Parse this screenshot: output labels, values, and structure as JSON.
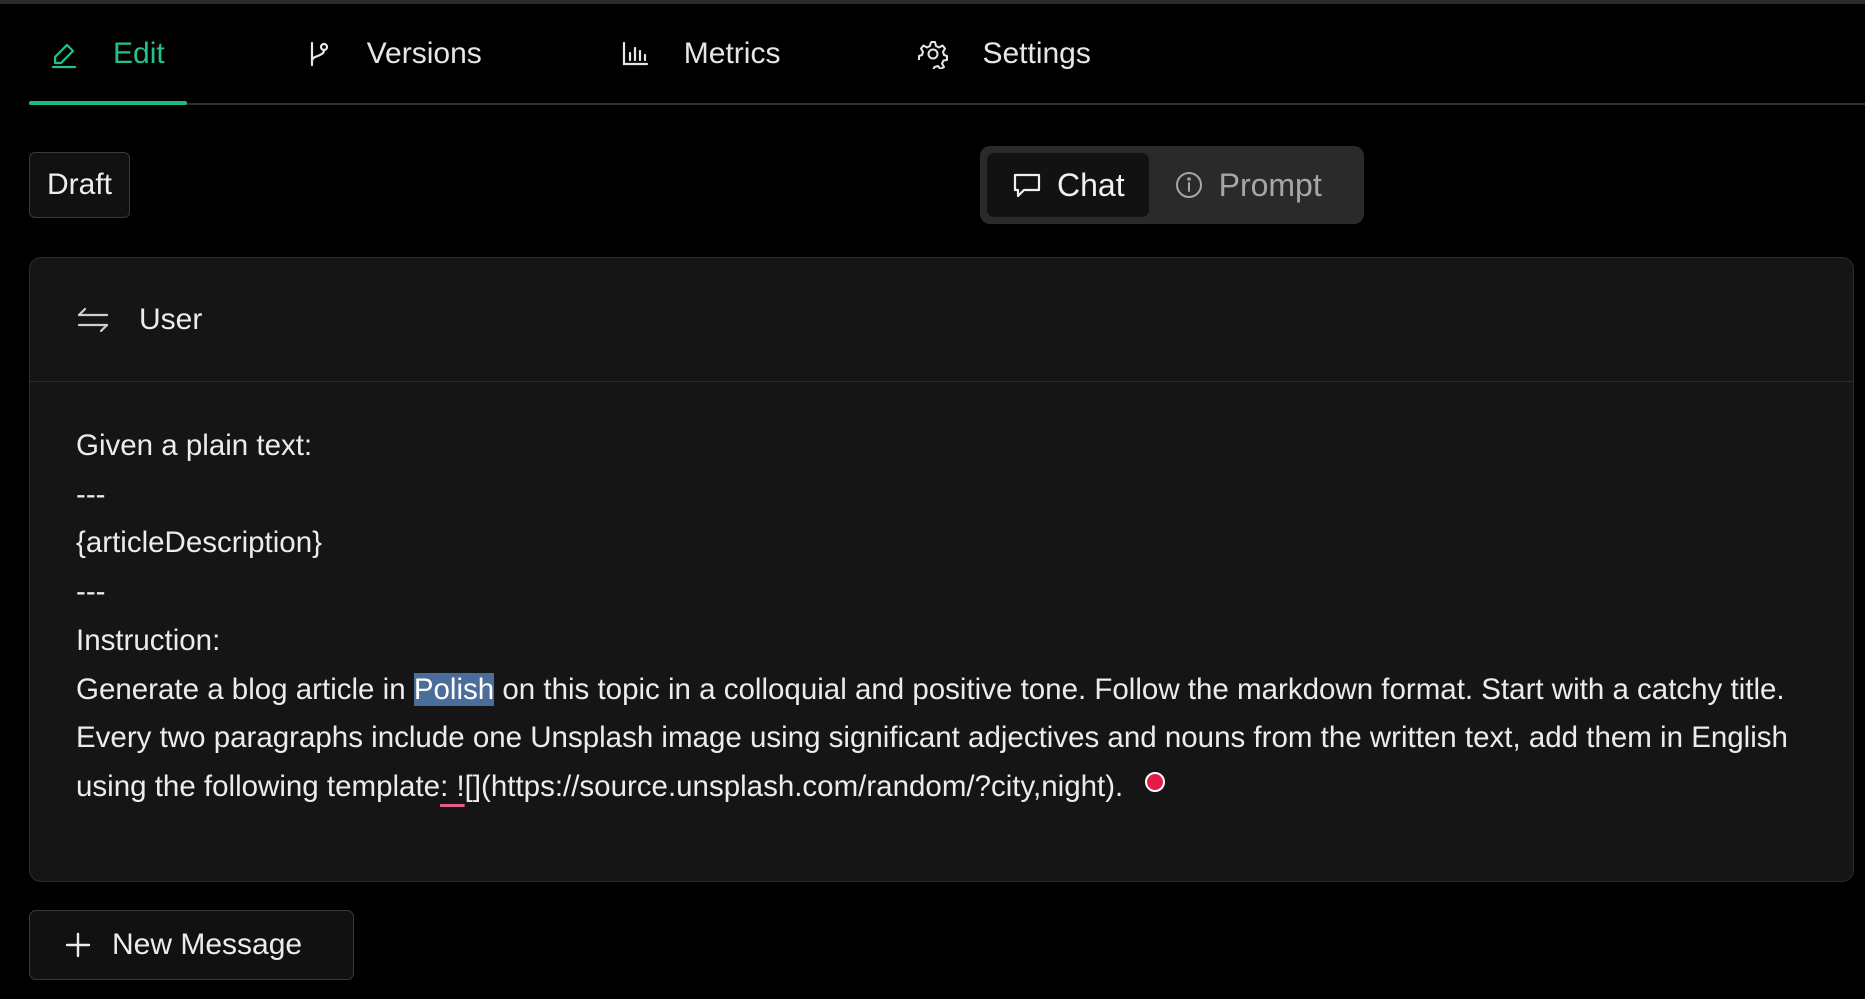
{
  "tabs": [
    {
      "label": "Edit",
      "icon": "pencil-icon",
      "active": true
    },
    {
      "label": "Versions",
      "icon": "git-branch-icon",
      "active": false
    },
    {
      "label": "Metrics",
      "icon": "bar-chart-icon",
      "active": false
    },
    {
      "label": "Settings",
      "icon": "gear-icon",
      "active": false
    }
  ],
  "status_badge": "Draft",
  "mode_toggle": {
    "chat_label": "Chat",
    "prompt_label": "Prompt",
    "selected": "Chat"
  },
  "message": {
    "role": "User",
    "lines": [
      "Given a plain text:",
      "---",
      "{articleDescription}",
      "---",
      "Instruction:"
    ],
    "instruction_before": "Generate a blog article in ",
    "instruction_selected": "Polish",
    "instruction_after": " on this topic in a colloquial and positive tone. Follow the markdown format. Start with a catchy title. Every two paragraphs include one Unsplash image using significant adjectives and nouns from the written text, add them in English using the following template",
    "instruction_flagged": ": !",
    "instruction_end": "[](https://source.unsplash.com/random/?city,night)."
  },
  "new_message_label": "New Message",
  "colors": {
    "accent": "#1fb981",
    "selection": "#4a6d99",
    "recording_dot": "#e11d48"
  }
}
